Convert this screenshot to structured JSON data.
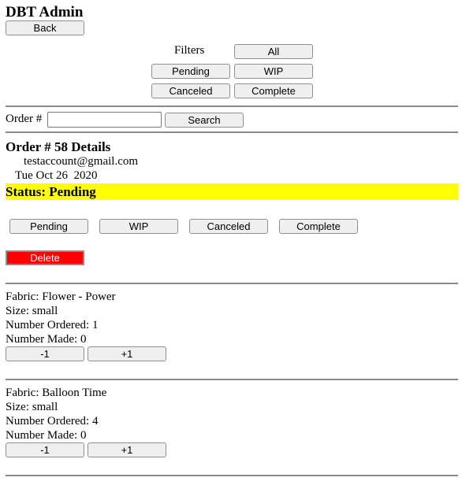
{
  "app": {
    "title": "DBT Admin",
    "back_label": "Back"
  },
  "filters": {
    "label": "Filters",
    "all": "All",
    "pending": "Pending",
    "wip": "WIP",
    "canceled": "Canceled",
    "complete": "Complete"
  },
  "search": {
    "label": "Order #",
    "input_value": "",
    "button_label": "Search"
  },
  "order": {
    "heading": "Order # 58 Details",
    "email": "testaccount@gmail.com",
    "date": "Tue Oct 26  2020",
    "status": "Status: Pending",
    "status_color": "#ffff00",
    "actions": {
      "pending": "Pending",
      "wip": "WIP",
      "canceled": "Canceled",
      "complete": "Complete"
    },
    "delete_label": "Delete",
    "delete_color": "#ff0000"
  },
  "items": [
    {
      "fabric": "Fabric: Flower - Power",
      "size": "Size: small",
      "ordered": "Number Ordered: 1",
      "made": "Number Made: 0",
      "minus": "-1",
      "plus": "+1"
    },
    {
      "fabric": "Fabric: Balloon Time",
      "size": "Size: small",
      "ordered": "Number Ordered: 4",
      "made": "Number Made: 0",
      "minus": "-1",
      "plus": "+1"
    }
  ]
}
